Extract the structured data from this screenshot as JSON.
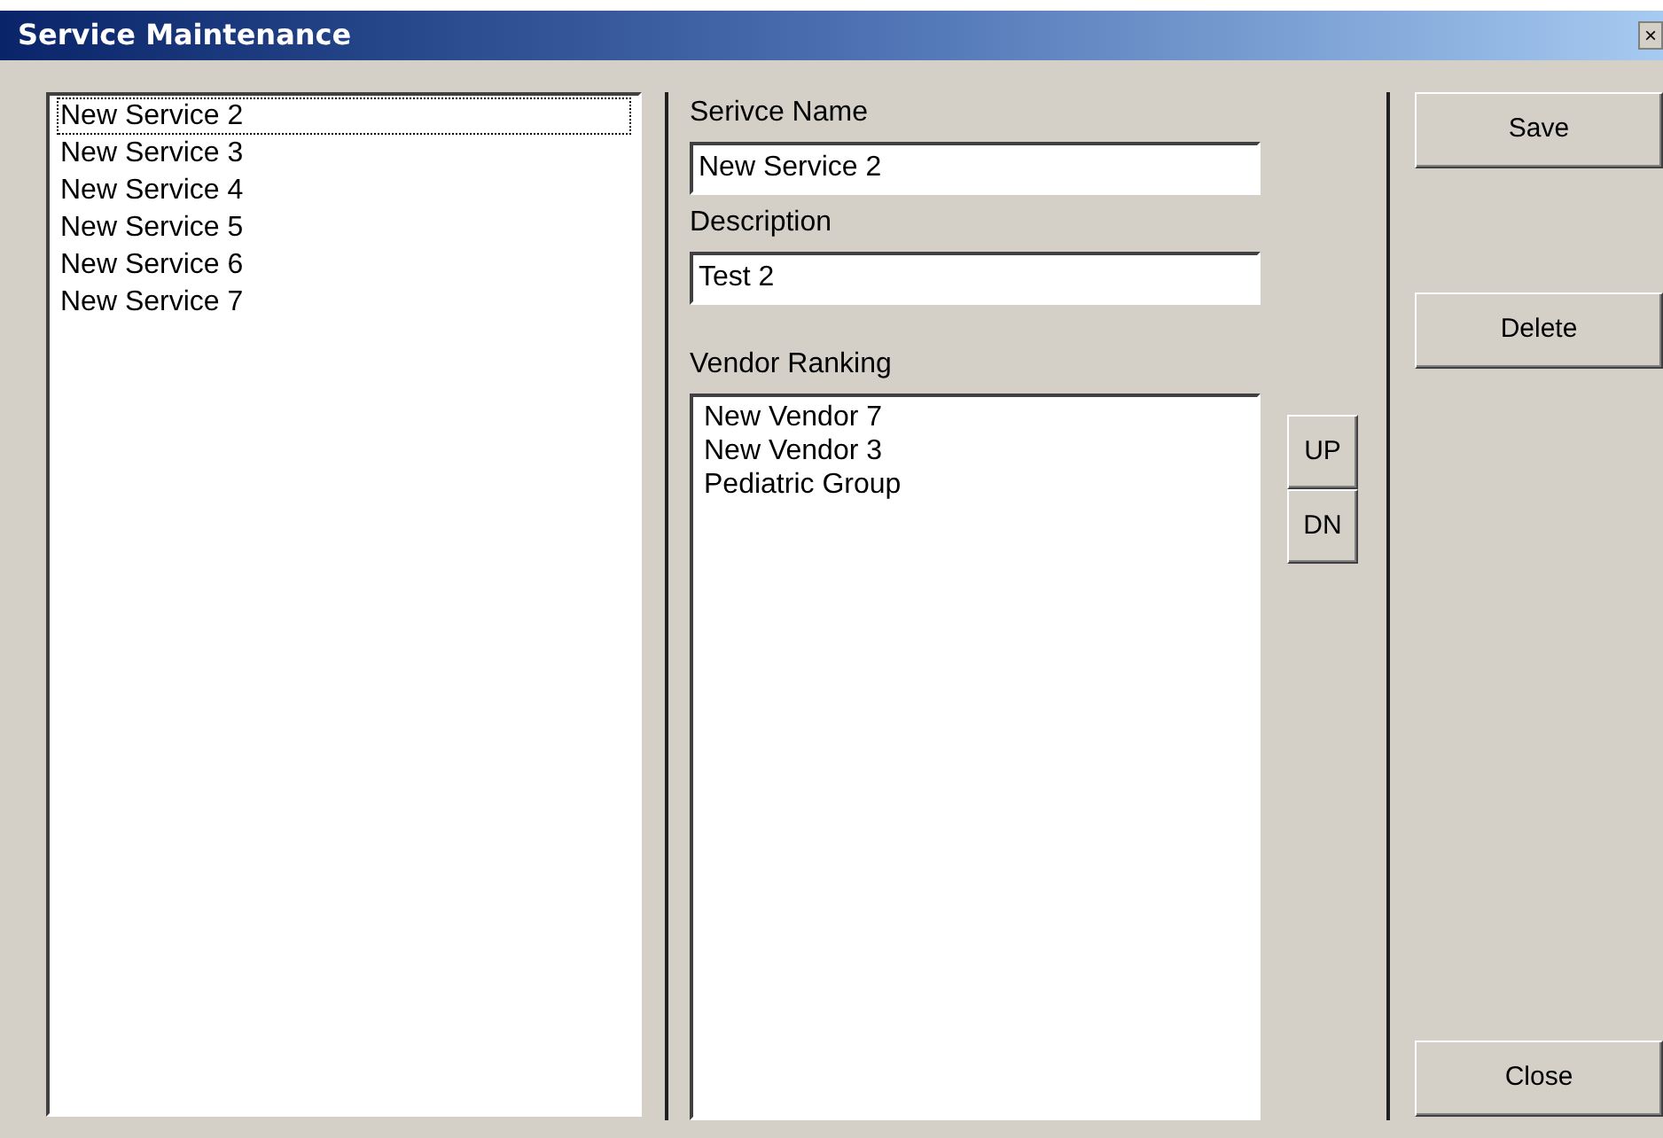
{
  "window": {
    "title": "Service Maintenance",
    "close": "×"
  },
  "services": [
    {
      "label": "New Service 2",
      "selected": true
    },
    {
      "label": "New Service 3",
      "selected": false
    },
    {
      "label": "New Service 4",
      "selected": false
    },
    {
      "label": "New Service 5",
      "selected": false
    },
    {
      "label": "New Service 6",
      "selected": false
    },
    {
      "label": "New Service 7",
      "selected": false
    }
  ],
  "service_name": {
    "label": "Serivce Name",
    "value": "New Service 2"
  },
  "description": {
    "label": "Description",
    "value": "Test 2"
  },
  "vendor_ranking": {
    "label": "Vendor Ranking",
    "items": [
      "New Vendor 7",
      "New Vendor 3",
      "Pediatric Group"
    ],
    "up": "UP",
    "down": "DN"
  },
  "buttons": {
    "save": "Save",
    "delete": "Delete",
    "close": "Close"
  }
}
